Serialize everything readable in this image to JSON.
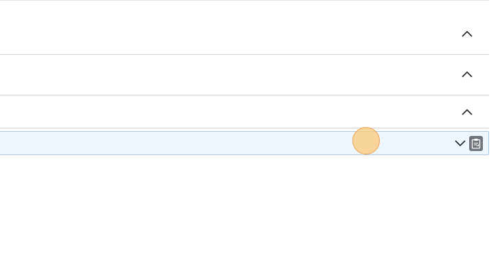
{
  "accordion": {
    "sections": [
      {
        "label": "",
        "state": "expanded",
        "toggle_icon": "chevron-up-icon"
      },
      {
        "label": "",
        "state": "expanded",
        "toggle_icon": "chevron-up-icon"
      },
      {
        "label": "",
        "state": "expanded",
        "toggle_icon": "chevron-up-icon"
      },
      {
        "label": "",
        "state": "collapsed",
        "toggle_icon": "chevron-down-icon",
        "action_icon": "clipboard-icon"
      }
    ]
  },
  "colors": {
    "active_row_background": "#eef6fd",
    "active_row_border": "#a9c9e6",
    "divider": "#d2d2d2",
    "chevron": "#222222",
    "clipboard_button": "#6f737a",
    "cursor_highlight": "#f9c878"
  },
  "cursor": {
    "indicator": "click-highlight"
  }
}
